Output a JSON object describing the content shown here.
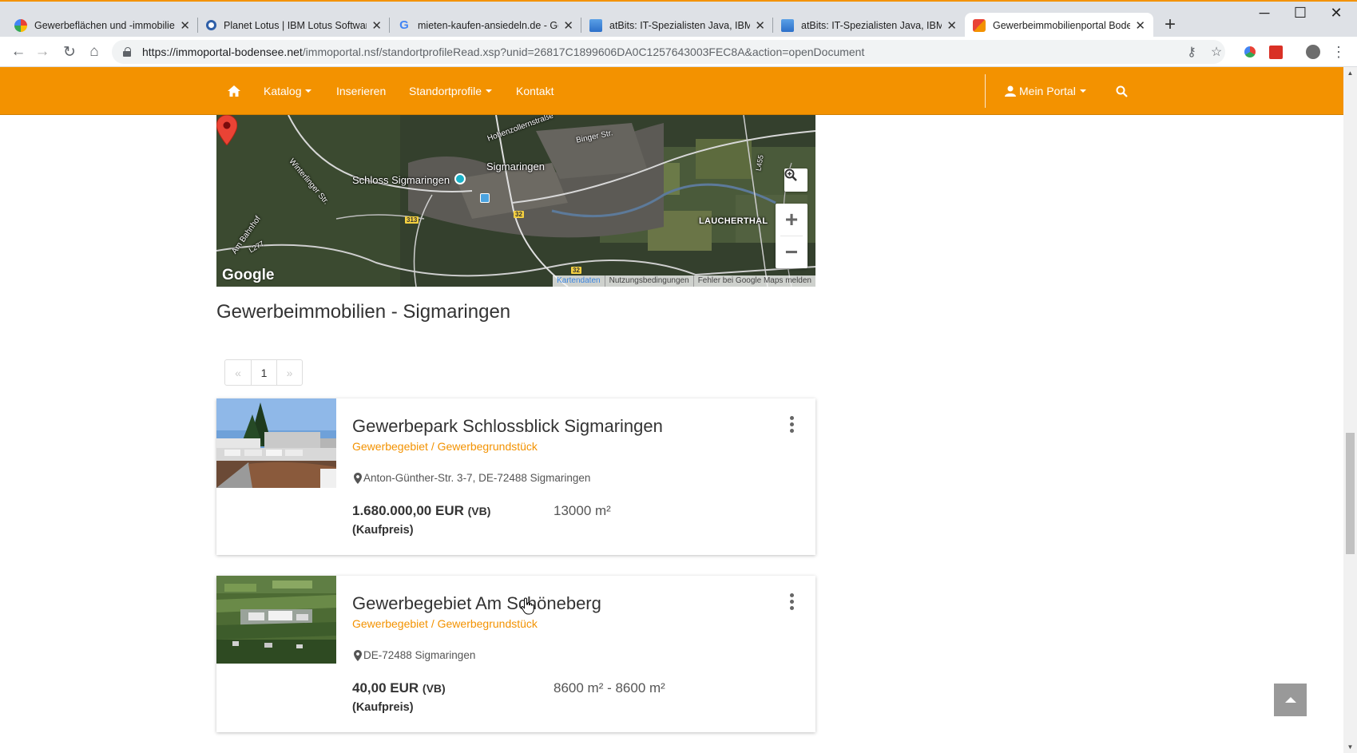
{
  "browser": {
    "tabs": [
      {
        "title": "Gewerbeflächen und -immobilien"
      },
      {
        "title": "Planet Lotus | IBM Lotus Software"
      },
      {
        "title": "mieten-kaufen-ansiedeln.de - Go"
      },
      {
        "title": "atBits: IT-Spezialisten Java, IBM L"
      },
      {
        "title": "atBits: IT-Spezialisten Java, IBM L"
      },
      {
        "title": "Gewerbeimmobilienportal Boden"
      }
    ],
    "url_host": "https://immoportal-bodensee.net",
    "url_path": "/immoportal.nsf/standortprofileRead.xsp?unid=26817C1899606DA0C1257643003FEC8A&action=openDocument"
  },
  "nav": {
    "home_icon": "home-icon",
    "katalog": "Katalog",
    "inserieren": "Inserieren",
    "standortprofile": "Standortprofile",
    "kontakt": "Kontakt",
    "mein_portal": "Mein Portal",
    "accent": "#f39200"
  },
  "map": {
    "labels": {
      "sigmaringen": "Sigmaringen",
      "schloss": "Schloss Sigmaringen",
      "laucherthal": "LAUCHERTHAL",
      "hohenzollern": "Hohenzollernstraße",
      "binger": "Binger Str.",
      "am_bahnhof": "Am Bahnhof",
      "winterlinger": "Winterlinger Str."
    },
    "roads": {
      "r313": "313",
      "r32a": "32",
      "r32b": "32",
      "l277": "L277",
      "l455": "L455"
    },
    "google": "Google",
    "footer": [
      "Kartendaten",
      "Nutzungsbedingungen",
      "Fehler bei Google Maps melden"
    ]
  },
  "page": {
    "heading": "Gewerbeimmobilien - Sigmaringen",
    "pager": {
      "prev": "«",
      "current": "1",
      "next": "»"
    }
  },
  "listings": [
    {
      "title": "Gewerbepark Schlossblick Sigmaringen",
      "category": "Gewerbegebiet / Gewerbegrundstück",
      "address": "Anton-Günther-Str. 3-7, DE-72488 Sigmaringen",
      "price": "1.680.000,00 EUR",
      "price_suffix": "(VB)",
      "price_label": "(Kaufpreis)",
      "area": "13000 m²"
    },
    {
      "title": "Gewerbegebiet Am Schöneberg",
      "category": "Gewerbegebiet / Gewerbegrundstück",
      "address": "DE-72488 Sigmaringen",
      "price": "40,00 EUR",
      "price_suffix": "(VB)",
      "price_label": "(Kaufpreis)",
      "area": "8600 m² - 8600 m²"
    }
  ]
}
